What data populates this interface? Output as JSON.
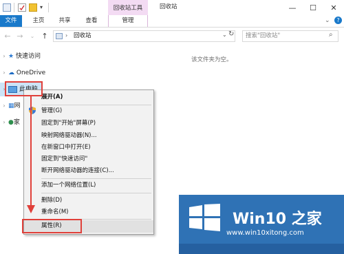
{
  "window": {
    "title": "回收站",
    "context_tab_group": "回收站工具",
    "minimize": "—",
    "maximize": "☐",
    "close": "✕",
    "help": "?"
  },
  "ribbon": {
    "tabs": [
      "文件",
      "主页",
      "共享",
      "查看",
      "管理"
    ]
  },
  "address_bar": {
    "path": "回收站",
    "search_placeholder": "搜索\"回收站\""
  },
  "nav_pane": {
    "items": [
      "快速访问",
      "OneDrive",
      "此电脑",
      "网",
      "家"
    ]
  },
  "content": {
    "empty_message": "该文件夹为空。"
  },
  "context_menu": {
    "items": [
      "展开(A)",
      "管理(G)",
      "固定到\"开始\"屏幕(P)",
      "映射网络驱动器(N)...",
      "在新窗口中打开(E)",
      "固定到\"快速访问\"",
      "断开网络驱动器的连接(C)...",
      "添加一个网络位置(L)",
      "删除(D)",
      "重命名(M)",
      "属性(R)"
    ]
  },
  "watermark": {
    "brand": "Win10 之家",
    "url": "www.win10xitong.com"
  },
  "colors": {
    "accent": "#1979ca",
    "context_tab": "#f3dbf3",
    "annotation_red": "#e0403a",
    "watermark_blue": "#2f72b5"
  }
}
